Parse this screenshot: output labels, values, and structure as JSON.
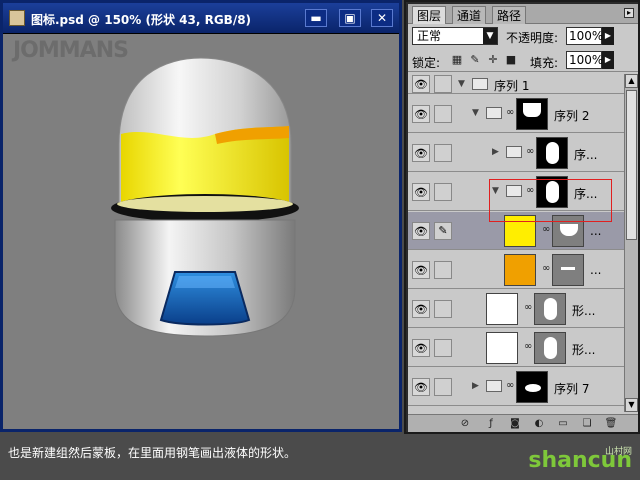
{
  "document": {
    "title": "图标.psd @ 150% (形状 43, RGB/8)",
    "watermark": "JOMMANS",
    "buttons": {
      "minimize": "▬",
      "restore": "▣",
      "close": "✕"
    }
  },
  "layers_panel": {
    "tabs": [
      "图层",
      "通道",
      "路径"
    ],
    "blend_mode": "正常",
    "opacity_label": "不透明度:",
    "opacity_value": "100%",
    "lock_label": "锁定:",
    "fill_label": "填充:",
    "fill_value": "100%",
    "layers": [
      {
        "name": "序列 1",
        "kind": "group",
        "expanded": true
      },
      {
        "name": "序列 2",
        "kind": "group",
        "expanded": true
      },
      {
        "name": "序...",
        "kind": "group",
        "expanded": false
      },
      {
        "name": "序...",
        "kind": "group",
        "expanded": true
      },
      {
        "name": "...",
        "kind": "layer",
        "color": "#ffee00",
        "selected": true
      },
      {
        "name": "...",
        "kind": "layer",
        "color": "#f0a000"
      },
      {
        "name": "形...",
        "kind": "layer",
        "color": "#ffffff"
      },
      {
        "name": "形...",
        "kind": "layer",
        "color": "#ffffff"
      },
      {
        "name": "序列 7",
        "kind": "group",
        "expanded": false
      }
    ]
  },
  "caption": "也是新建组然后蒙板，在里面用钢笔画出液体的形状。",
  "site_logo": "shancun",
  "site_logo_sub": "山村网",
  "colors": {
    "liquid_yellow": "#ffee00",
    "liquid_orange": "#f0a000",
    "visor_blue": "#1a6fc0",
    "highlight_box": "#e02020"
  }
}
